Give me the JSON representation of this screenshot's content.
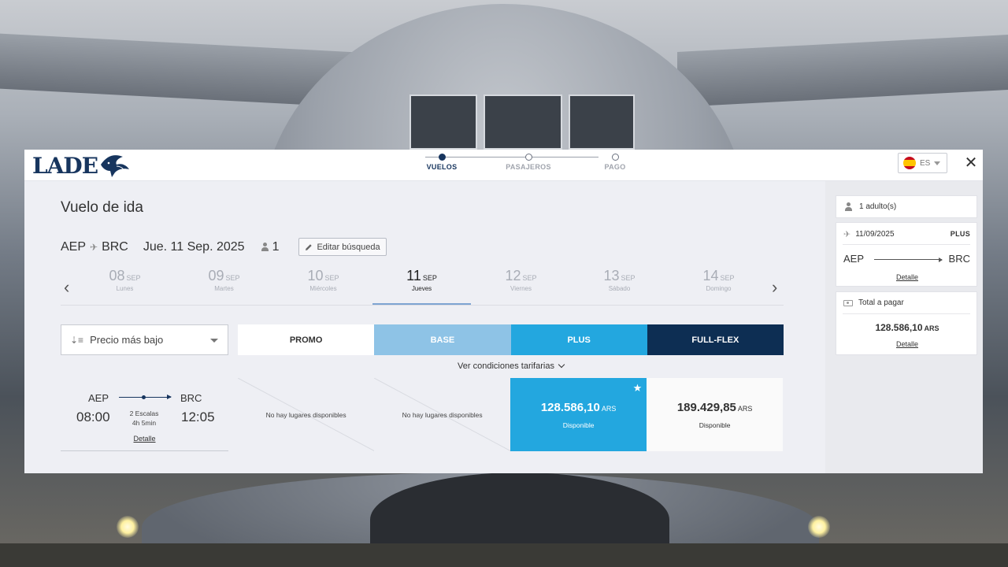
{
  "brand": {
    "logo_text": "LADE"
  },
  "steps": [
    {
      "label": "VUELOS",
      "active": true
    },
    {
      "label": "PASAJEROS",
      "active": false
    },
    {
      "label": "PAGO",
      "active": false
    }
  ],
  "language": {
    "code": "ES",
    "icon": "spain-flag-icon"
  },
  "close_icon": "close-icon",
  "page_title": "Vuelo de ida",
  "search": {
    "origin": "AEP",
    "destination": "BRC",
    "date": "Jue. 11 Sep. 2025",
    "passengers": "1",
    "edit_label": "Editar búsqueda"
  },
  "dates": [
    {
      "day": "08",
      "month": "SEP",
      "weekday": "Lunes"
    },
    {
      "day": "09",
      "month": "SEP",
      "weekday": "Martes"
    },
    {
      "day": "10",
      "month": "SEP",
      "weekday": "Miércoles"
    },
    {
      "day": "11",
      "month": "SEP",
      "weekday": "Jueves",
      "active": true
    },
    {
      "day": "12",
      "month": "SEP",
      "weekday": "Viernes"
    },
    {
      "day": "13",
      "month": "SEP",
      "weekday": "Sábado"
    },
    {
      "day": "14",
      "month": "SEP",
      "weekday": "Domingo"
    }
  ],
  "sort": {
    "label": "Precio más bajo"
  },
  "fare_types": {
    "promo": "PROMO",
    "base": "BASE",
    "plus": "PLUS",
    "flex": "FULL-FLEX"
  },
  "conditions_label": "Ver condiciones tarifarias",
  "flight": {
    "origin": "AEP",
    "destination": "BRC",
    "departure": "08:00",
    "arrival": "12:05",
    "stops": "2 Escalas",
    "duration": "4h 5min",
    "detail_label": "Detalle",
    "fares": {
      "promo": "No hay lugares disponibles",
      "base": "No hay lugares disponibles",
      "plus": {
        "price": "128.586,10",
        "currency": "ARS",
        "status": "Disponible"
      },
      "flex": {
        "price": "189.429,85",
        "currency": "ARS",
        "status": "Disponible"
      }
    }
  },
  "summary": {
    "passengers": "1 adulto(s)",
    "flight_date": "11/09/2025",
    "fare_tag": "PLUS",
    "origin": "AEP",
    "destination": "BRC",
    "detail_label": "Detalle",
    "total_label": "Total a pagar",
    "total_amount": "128.586,10",
    "total_currency": "ARS",
    "total_detail_label": "Detalle"
  },
  "colors": {
    "navy": "#17355e",
    "base": "#8ec3e6",
    "plus": "#23a7df",
    "flex": "#0d2e53"
  }
}
